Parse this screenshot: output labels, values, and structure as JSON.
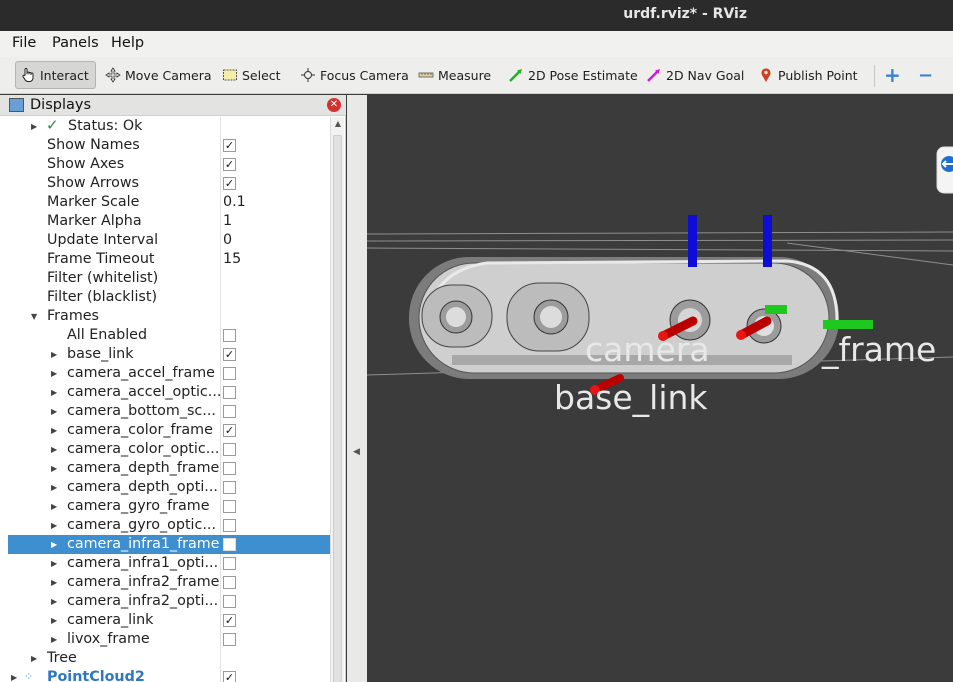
{
  "window": {
    "title": "urdf.rviz* - RViz"
  },
  "menu": {
    "file": "File",
    "panels": "Panels",
    "help": "Help"
  },
  "toolbar": {
    "interact": "Interact",
    "move_camera": "Move Camera",
    "select": "Select",
    "focus_camera": "Focus Camera",
    "measure": "Measure",
    "pose_estimate": "2D Pose Estimate",
    "nav_goal": "2D Nav Goal",
    "publish_point": "Publish Point",
    "zoom_in": "+",
    "zoom_out": "−"
  },
  "displays": {
    "title": "Displays",
    "rows": [
      {
        "label": "Status: Ok"
      },
      {
        "label": "Show Names",
        "checked": "✓"
      },
      {
        "label": "Show Axes",
        "checked": "✓"
      },
      {
        "label": "Show Arrows",
        "checked": "✓"
      },
      {
        "label": "Marker Scale",
        "value": "0.1"
      },
      {
        "label": "Marker Alpha",
        "value": "1"
      },
      {
        "label": "Update Interval",
        "value": "0"
      },
      {
        "label": "Frame Timeout",
        "value": "15"
      },
      {
        "label": "Filter (whitelist)"
      },
      {
        "label": "Filter (blacklist)"
      },
      {
        "label": "Frames"
      },
      {
        "label": "All Enabled",
        "checked": ""
      },
      {
        "label": "base_link",
        "checked": "✓"
      },
      {
        "label": "camera_accel_frame",
        "checked": ""
      },
      {
        "label": "camera_accel_optic...",
        "checked": ""
      },
      {
        "label": "camera_bottom_sc...",
        "checked": ""
      },
      {
        "label": "camera_color_frame",
        "checked": "✓"
      },
      {
        "label": "camera_color_optic...",
        "checked": ""
      },
      {
        "label": "camera_depth_frame",
        "checked": ""
      },
      {
        "label": "camera_depth_opti...",
        "checked": ""
      },
      {
        "label": "camera_gyro_frame",
        "checked": ""
      },
      {
        "label": "camera_gyro_optic...",
        "checked": ""
      },
      {
        "label": "camera_infra1_frame",
        "checked": ""
      },
      {
        "label": "camera_infra1_opti...",
        "checked": ""
      },
      {
        "label": "camera_infra2_frame",
        "checked": ""
      },
      {
        "label": "camera_infra2_opti...",
        "checked": ""
      },
      {
        "label": "camera_link",
        "checked": "✓"
      },
      {
        "label": "livox_frame",
        "checked": ""
      },
      {
        "label": "Tree"
      },
      {
        "label": "PointCloud2",
        "checked": "✓"
      }
    ]
  },
  "viewport": {
    "labels": {
      "camera": "camera",
      "frame": "_frame",
      "base_link": "base_link"
    },
    "colors": {
      "background": "#3b3b3b",
      "x_axis": "#d10f0f",
      "y_axis": "#1ec81e",
      "z_axis": "#0d0dd6",
      "label": "#e8e8e8"
    }
  }
}
